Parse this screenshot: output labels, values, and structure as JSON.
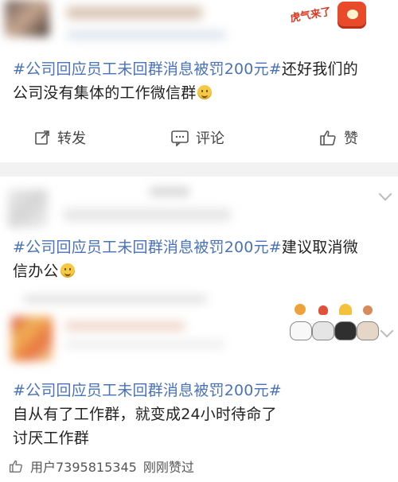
{
  "posts": [
    {
      "topic": "#公司回应员工未回群消息被罚200元#",
      "text_after_topic": "还好我们的",
      "text_line2": "公司没有集体的工作微信群",
      "badge_text": "虎气来了",
      "actions": {
        "repost": "转发",
        "comment": "评论",
        "like": "赞"
      }
    },
    {
      "topic": "#公司回应员工未回群消息被罚200元#",
      "text_after_topic": "建议取消微",
      "text_line2": "信办公"
    },
    {
      "topic": "#公司回应员工未回群消息被罚200元#",
      "text_line2": "自从有了工作群，就变成24小时待命了",
      "text_line3": "讨厌工作群",
      "like_user": "用户7395815345",
      "like_suffix": "刚刚赞过"
    }
  ],
  "colors": {
    "topic": "#4a72b8",
    "text": "#222222",
    "separator": "#f2f2f2",
    "muted": "#555555"
  },
  "icons": [
    "repost-icon",
    "comment-icon",
    "thumb-up-icon",
    "chevron-down-icon",
    "smile-emoji-icon"
  ]
}
